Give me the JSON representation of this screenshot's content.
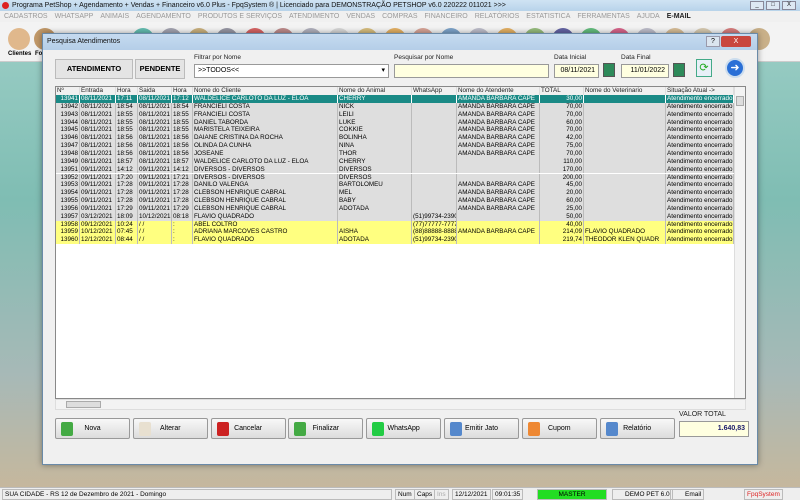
{
  "window": {
    "title": "Programa PetShop + Agendamento + Vendas + Financeiro v6.0 Plus - FpqSystem ® | Licenciado para  DEMONSTRAÇÃO PETSHOP v6.0 220222 011021 >>>",
    "controls": [
      "_",
      "□",
      "X"
    ]
  },
  "menu": [
    "CADASTROS",
    "WHATSAPP",
    "ANIMAIS",
    "AGENDAMENTO",
    "PRODUTOS E SERVIÇOS",
    "ATENDIMENTO",
    "VENDAS",
    "COMPRAS",
    "FINANCEIRO",
    "RELATÓRIOS",
    "ESTATISTICA",
    "FERRAMENTAS",
    "AJUDA",
    "E-MAIL"
  ],
  "toolbar": {
    "first_label": "Clientes",
    "second_label": "Fo"
  },
  "dialog": {
    "title": "Pesquisa Atendimentos",
    "help": "?",
    "close": "X",
    "tab_atendimento": "ATENDIMENTO",
    "tab_pendente": "PENDENTE",
    "filter_label": "Filtrar por Nome",
    "filter_value": ">>TODOS<<",
    "search_label": "Pesquisar por Nome",
    "search_value": "",
    "date_start_label": "Data Inicial",
    "date_start": "08/11/2021",
    "date_end_label": "Data Final",
    "date_end": "11/01/2022",
    "columns": [
      "Nº",
      "Entrada",
      "Hora",
      "Saida",
      "Hora",
      "Nome do Cliente",
      "Nome do Animal",
      "WhatsApp",
      "Nome do Atendente",
      "TOTAL",
      "Nome do Veterinario",
      "Situação Atual ->"
    ],
    "rows": [
      [
        "13941",
        "08/11/2021",
        "17:11",
        "08/11/2021",
        "17:12",
        "WALDELICE CARLOTO DA LUZ - ELOA",
        "CHERRY",
        "",
        "AMANDA BARBARA CAPE",
        "30,00",
        "",
        "Atendimento encerrado",
        "sel"
      ],
      [
        "13942",
        "08/11/2021",
        "18:54",
        "08/11/2021",
        "18:54",
        "FRANCIELI COSTA",
        "NICK",
        "",
        "AMANDA BARBARA CAPE",
        "70,00",
        "",
        "Atendimento encerrado",
        "norm"
      ],
      [
        "13943",
        "08/11/2021",
        "18:55",
        "08/11/2021",
        "18:55",
        "FRANCIELI COSTA",
        "LEILI",
        "",
        "AMANDA BARBARA CAPE",
        "70,00",
        "",
        "Atendimento encerrado",
        "norm"
      ],
      [
        "13944",
        "08/11/2021",
        "18:55",
        "08/11/2021",
        "18:55",
        "DANIEL TABORDA",
        "LUKE",
        "",
        "AMANDA BARBARA CAPE",
        "60,00",
        "",
        "Atendimento encerrado",
        "norm"
      ],
      [
        "13945",
        "08/11/2021",
        "18:55",
        "08/11/2021",
        "18:55",
        "MARISTELA TEIXEIRA",
        "COKKIE",
        "",
        "AMANDA BARBARA CAPE",
        "70,00",
        "",
        "Atendimento encerrado",
        "norm"
      ],
      [
        "13946",
        "08/11/2021",
        "18:56",
        "08/11/2021",
        "18:56",
        "DAIANE CRISTINA DA ROCHA",
        "BOLINHA",
        "",
        "AMANDA BARBARA CAPE",
        "42,00",
        "",
        "Atendimento encerrado",
        "norm"
      ],
      [
        "13947",
        "08/11/2021",
        "18:56",
        "08/11/2021",
        "18:56",
        "OLINDA DA CUNHA",
        "NINA",
        "",
        "AMANDA BARBARA CAPE",
        "75,00",
        "",
        "Atendimento encerrado",
        "norm"
      ],
      [
        "13948",
        "08/11/2021",
        "18:56",
        "08/11/2021",
        "18:56",
        "JOSEANE",
        "THOR",
        "",
        "AMANDA BARBARA CAPE",
        "70,00",
        "",
        "Atendimento encerrado",
        "norm"
      ],
      [
        "13949",
        "08/11/2021",
        "18:57",
        "08/11/2021",
        "18:57",
        "WALDELICE CARLOTO DA LUZ - ELOA",
        "CHERRY",
        "",
        "",
        "110,00",
        "",
        "Atendimento encerrado",
        "norm"
      ],
      [
        "13951",
        "09/11/2021",
        "14:12",
        "09/11/2021",
        "14:12",
        "DIVERSOS - DIVERSOS",
        "DIVERSOS",
        "",
        "",
        "170,00",
        "",
        "Atendimento encerrado",
        "norm"
      ],
      [
        "13952",
        "09/11/2021",
        "17:20",
        "09/11/2021",
        "17:21",
        "DIVERSOS - DIVERSOS",
        "DIVERSOS",
        "",
        "",
        "200,00",
        "",
        "Atendimento encerrado",
        "norm"
      ],
      [
        "13953",
        "09/11/2021",
        "17:28",
        "09/11/2021",
        "17:28",
        "DANILO VALENGA",
        "BARTOLOMEU",
        "",
        "AMANDA BARBARA CAPE",
        "45,00",
        "",
        "Atendimento encerrado",
        "norm"
      ],
      [
        "13954",
        "09/11/2021",
        "17:28",
        "09/11/2021",
        "17:28",
        "CLEBSON HENRIQUE CABRAL",
        "MEL",
        "",
        "AMANDA BARBARA CAPE",
        "20,00",
        "",
        "Atendimento encerrado",
        "norm"
      ],
      [
        "13955",
        "09/11/2021",
        "17:28",
        "09/11/2021",
        "17:28",
        "CLEBSON HENRIQUE CABRAL",
        "BABY",
        "",
        "AMANDA BARBARA CAPE",
        "60,00",
        "",
        "Atendimento encerrado",
        "norm"
      ],
      [
        "13956",
        "09/11/2021",
        "17:29",
        "09/11/2021",
        "17:29",
        "CLEBSON HENRIQUE CABRAL",
        "ADOTADA",
        "",
        "AMANDA BARBARA CAPE",
        "25,00",
        "",
        "Atendimento encerrado",
        "norm"
      ],
      [
        "13957",
        "03/12/2021",
        "18:09",
        "10/12/2021",
        "08:18",
        "FLAVIO QUADRADO",
        "",
        "(51)99734-2390",
        "",
        "50,00",
        "",
        "Atendimento encerrado",
        "norm"
      ],
      [
        "13958",
        "09/12/2021",
        "10:24",
        "/ /",
        ":",
        "ABEL COLTRO",
        "",
        "(77)77777-7777",
        "",
        "40,00",
        "",
        "Atendimento encerrado",
        "yel"
      ],
      [
        "13959",
        "10/12/2021",
        "07:45",
        "/ /",
        ":",
        "ADRIANA MARCOVES CASTRO",
        "AISHA",
        "(88)88888-8888",
        "AMANDA BARBARA CAPE",
        "214,09",
        "FLAVIO QUADRADO",
        "Atendimento encerrado",
        "yel"
      ],
      [
        "13960",
        "12/12/2021",
        "08:44",
        "/ /",
        ":",
        "FLAVIO QUADRADO",
        "ADOTADA",
        "(51)99734-2390",
        "",
        "219,74",
        "THEODOR KLEN QUADR",
        "Atendimento encerrado",
        "yel"
      ]
    ],
    "buttons": [
      "Nova",
      "Alterar",
      "Cancelar",
      "Finalizar",
      "WhatsApp",
      "Emitir Jato",
      "Cupom",
      "Relatório"
    ],
    "total_label": "VALOR TOTAL",
    "total_value": "1.640,83"
  },
  "statusbar": {
    "location": "SUA CIDADE - RS 12 de Dezembro de 2021 - Domingo",
    "num": "Num",
    "caps": "Caps",
    "ins": "Ins",
    "date": "12/12/2021",
    "time": "09:01:35",
    "user": "MASTER",
    "version": "DEMO PET 6.0",
    "email": "Email",
    "brand": "FpqSystem"
  },
  "colors": {
    "selected_row": "#1a8a86",
    "pending_row": "#ffff80",
    "user_badge": "#22dd22"
  }
}
